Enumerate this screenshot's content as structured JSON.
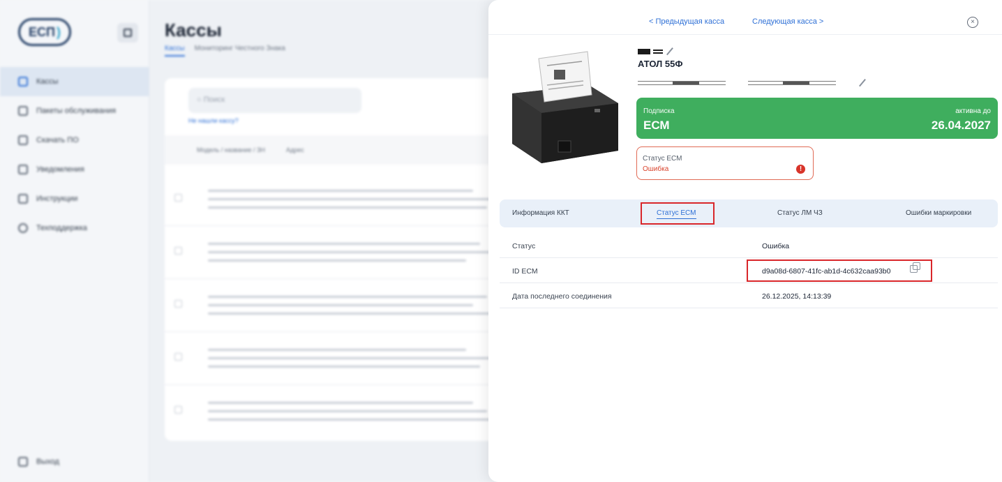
{
  "sidebar": {
    "logo": "ЕСП",
    "items": [
      {
        "label": "Кассы",
        "active": true
      },
      {
        "label": "Пакеты обслуживания",
        "active": false
      },
      {
        "label": "Скачать ПО",
        "active": false
      },
      {
        "label": "Уведомления",
        "active": false
      },
      {
        "label": "Инструкции",
        "active": false
      },
      {
        "label": "Техподдержка",
        "active": false
      }
    ],
    "logout_label": "Выход"
  },
  "main": {
    "title": "Кассы",
    "tabs": [
      "Кассы",
      "Мониторинг Честного Знака"
    ],
    "search_placeholder": "Поиск",
    "search_link": "Не нашли кассу?",
    "columns": [
      "Модель / название / ЗН",
      "Адрес"
    ]
  },
  "panel": {
    "prev_label": "< Предыдущая касса",
    "next_label": "Следующая касса >",
    "close_icon": "×",
    "model": "АТОЛ 55Ф",
    "subscription": {
      "label": "Подписка",
      "name": "ЕСМ",
      "until_label": "активна до",
      "until_date": "26.04.2027",
      "color": "#3fae5e"
    },
    "esm_status": {
      "label": "Статус ЕСМ",
      "value": "Ошибка",
      "icon": "!",
      "color": "#d9432c"
    },
    "tabs": [
      {
        "label": "Информация ККТ"
      },
      {
        "label": "Статус ЕСМ",
        "active": true
      },
      {
        "label": "Статус ЛМ ЧЗ"
      },
      {
        "label": "Ошибки маркировки"
      }
    ],
    "info_rows": [
      {
        "key": "Статус",
        "value": "Ошибка"
      },
      {
        "key": "ID ЕСМ",
        "value": "d9a08d-6807-41fc-ab1d-4c632caa93b0"
      },
      {
        "key": "Дата последнего соединения",
        "value": "26.12.2025, 14:13:39"
      }
    ],
    "highlight_color": "#d9262a"
  }
}
